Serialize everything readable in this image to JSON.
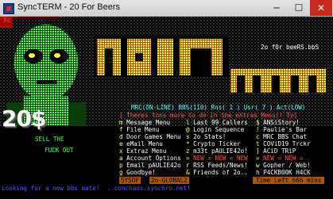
{
  "window": {
    "title": "SyncTERM - 20 For Beers",
    "minimize": "─",
    "maximize": "☐",
    "close": "✕"
  },
  "banner": {
    "xc": "Xc",
    "tagline": "2o f0r beeRS.bbS",
    "logo_main": "MAIN",
    "logo_menu": "menu",
    "price": "20$",
    "sell_text_1": "SELL THE",
    "sell_text_2": "FUCK OUT"
  },
  "status": {
    "line": "MRC(ON-LINE) BBS(110) Rns( 1 ) Usr( 7 ) Act(LOW)",
    "mrc": "MRC",
    "mrc_state": "ON-LINE",
    "bbs_label": "BBS",
    "bbs_count": "110",
    "rns_label": "Rns",
    "rns_count": "1",
    "usr_label": "Usr",
    "usr_count": "7",
    "act_label": "Act",
    "act_state": "LOW"
  },
  "notice": "[ Theres tons more to do in the eXtras Menu!! Ty]",
  "menu": {
    "col1": [
      {
        "key": "m",
        "label": "Message Menu"
      },
      {
        "key": "f",
        "label": "File Menu"
      },
      {
        "key": "d",
        "label": "Door Games Menu"
      },
      {
        "key": "e",
        "label": "eMail Menu"
      },
      {
        "key": "x",
        "label": "Extraz Menu"
      },
      {
        "key": "a",
        "label": "Account Options"
      },
      {
        "key": "p",
        "label": "Email pAULIE42o"
      },
      {
        "key": "g",
        "label": "Goodbye!"
      }
    ],
    "col2": [
      {
        "key": "l",
        "label": "Last 99 Callers"
      },
      {
        "key": "@",
        "label": "Login Sequence"
      },
      {
        "key": "s",
        "label": "2o Stats!"
      },
      {
        "key": "*",
        "label": "Crypto Ticker"
      },
      {
        "key": "z",
        "label": "m33t pAULIE42o!"
      },
      {
        "key": "=",
        "label": "NEW = NEW = NEW"
      },
      {
        "key": "r",
        "label": "RSS Feeds/News!"
      },
      {
        "key": "&",
        "label": "Friends of 2o.."
      }
    ],
    "col3": [
      {
        "key": "$",
        "label": "ANSiStory!"
      },
      {
        "key": "!",
        "label": "Paulie's Bar"
      },
      {
        "key": "c",
        "label": "MRC BBS Chat"
      },
      {
        "key": "t",
        "label": "COViD19 Trckr"
      },
      {
        "key": "]",
        "label": "ACiD TRiP"
      },
      {
        "key": "=",
        "label": "NEW = NEW ="
      },
      {
        "key": "w",
        "label": "Gopher / Web!"
      },
      {
        "key": "h",
        "label": "P4CKB00K H4CK"
      }
    ]
  },
  "bottom": {
    "sysop_tag": "SYSOP",
    "net_tag": "2o-GLOBAL2",
    "time_left": "Time Left 666 mins",
    "footer": "Looking for a new bbs mate!  ..conchaos.synchro.net!"
  },
  "colors": {
    "alien_green": "#55ff55",
    "logo_yellow": "#ffff55",
    "accent_red": "#ff5555",
    "cyan": "#55ffff"
  }
}
